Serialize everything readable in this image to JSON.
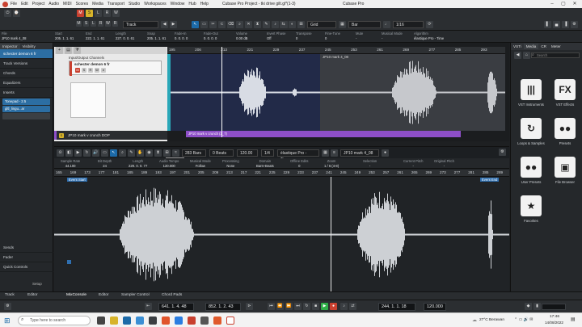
{
  "title_bar": {
    "app_title": "Cubase Pro Project - tki drive gilt.gl*(1-3)",
    "right_title": "Cubase Pro",
    "menu": [
      "File",
      "Edit",
      "Project",
      "Audio",
      "MIDI",
      "Scores",
      "Media",
      "Transport",
      "Studio",
      "Workspaces",
      "Window",
      "Hub",
      "Help"
    ]
  },
  "toolbar": {
    "track_select": "Track",
    "snap_value": "Grid",
    "grid_type": "Bar",
    "quantize": "1/16",
    "letters": [
      "M",
      "S",
      "L",
      "R",
      "W",
      "R"
    ]
  },
  "info_line": {
    "columns": [
      {
        "label": "File",
        "value": "JP10 mark 4_08"
      },
      {
        "label": "Start",
        "value": "205. 1. 1. 61"
      },
      {
        "label": "End",
        "value": "222. 1. 1. 61"
      },
      {
        "label": "Length",
        "value": "227. 0. 0. 61"
      },
      {
        "label": "Snap",
        "value": "205. 1. 1. 61"
      },
      {
        "label": "Fade-In",
        "value": "0. 0. 0. 0"
      },
      {
        "label": "Fade-Out",
        "value": "0. 0. 0. 0"
      },
      {
        "label": "Volume",
        "value": "0.00 dB"
      },
      {
        "label": "Invert Phase",
        "value": "Off"
      },
      {
        "label": "Transpose",
        "value": "0"
      },
      {
        "label": "Fine-Tune",
        "value": "0"
      },
      {
        "label": "Mute",
        "value": "-"
      },
      {
        "label": "Musical Mode",
        "value": "-"
      },
      {
        "label": "Algorithm",
        "value": "élastique Pro - Time"
      }
    ]
  },
  "inspector": {
    "tabs": [
      "Inspector",
      "Visibility"
    ],
    "track_name": "schecter demon 6 fr",
    "sections": [
      "Track Versions",
      "Chords",
      "Equalizers",
      "Inserts"
    ],
    "inserts": [
      "Tonepad - 2.5",
      "gltl_lingu...ar"
    ],
    "bottom_sections": [
      "Sends",
      "Fader",
      "Quick Controls"
    ],
    "setup_label": "Setup"
  },
  "project": {
    "ruler": [
      "195",
      "206",
      "213",
      "221",
      "229",
      "237",
      "245",
      "253",
      "261",
      "269",
      "277",
      "285",
      "293"
    ],
    "clip_label": "JP10 mark 4_08",
    "track_name": "JP10 mark v crunch DOP",
    "io_label": "Input/Output Channels",
    "channel_name": "schecter demon 6 fr",
    "event_label": "JP10 mark v crunch (3_7)"
  },
  "editor_toolbar": {
    "bars": "283 Bars",
    "beats": "0 Beats",
    "tempo": "120.00",
    "signature": "1/4",
    "algorithm": "élastique Pro - Time",
    "clip_name": "JP10 mark 4_08",
    "tooltip": "Show (E)"
  },
  "editor_info": {
    "columns": [
      {
        "label": "Sample Rate",
        "value": "44.100"
      },
      {
        "label": "Bit Depth",
        "value": "24"
      },
      {
        "label": "Length",
        "value": "229. 0. 0. 77"
      },
      {
        "label": "Audio Tempo",
        "value": "120.000"
      },
      {
        "label": "Musical Mode",
        "value": "Follow"
      },
      {
        "label": "Processing",
        "value": "None"
      },
      {
        "label": "Domain",
        "value": "Bars+Beats"
      },
      {
        "label": "Offline Edits",
        "value": "0"
      },
      {
        "label": "Zoom",
        "value": "1 / 6 (4-8)"
      },
      {
        "label": "Selection",
        "value": "-"
      },
      {
        "label": "Current Pitch",
        "value": "-"
      },
      {
        "label": "Original Pitch",
        "value": "-"
      }
    ],
    "ruler": [
      "165",
      "169",
      "173",
      "177",
      "181",
      "185",
      "189",
      "193",
      "197",
      "201",
      "205",
      "209",
      "213",
      "217",
      "221",
      "225",
      "229",
      "233",
      "237",
      "241",
      "245",
      "249",
      "253",
      "257",
      "261",
      "265",
      "269",
      "273",
      "277",
      "281",
      "285",
      "289"
    ],
    "event_start": "Event Start",
    "event_end": "Event End"
  },
  "right_zone": {
    "tabs": [
      "VSTi",
      "Media",
      "CR",
      "Meter"
    ],
    "active_tab": "Media",
    "search_placeholder": "Search",
    "tiles": [
      "VST Instruments",
      "VST Effects",
      "Loops & Samples",
      "Presets",
      "User Presets",
      "File Browser",
      "Favorites"
    ]
  },
  "bottom_tabs": [
    "Track",
    "Editor",
    "MixConsole",
    "Editor",
    "Sampler Control",
    "Chord Pads"
  ],
  "transport": {
    "left_locator": "641. 1. 4. 48",
    "right_locator": "852. 1. 2. 43",
    "position": "244. 1. 1. 18",
    "tempo": "120.000"
  },
  "taskbar": {
    "search_placeholder": "Type here to search",
    "weather": "27°C Berawan",
    "time": "17:46",
    "date": "14/08/2022"
  },
  "colors": {
    "accent_blue": "#1c6aa8",
    "record_red": "#c8402f",
    "play_green": "#2eae48",
    "event_purple": "#8e4fc8",
    "waveform_selected": "#2b4c86"
  }
}
